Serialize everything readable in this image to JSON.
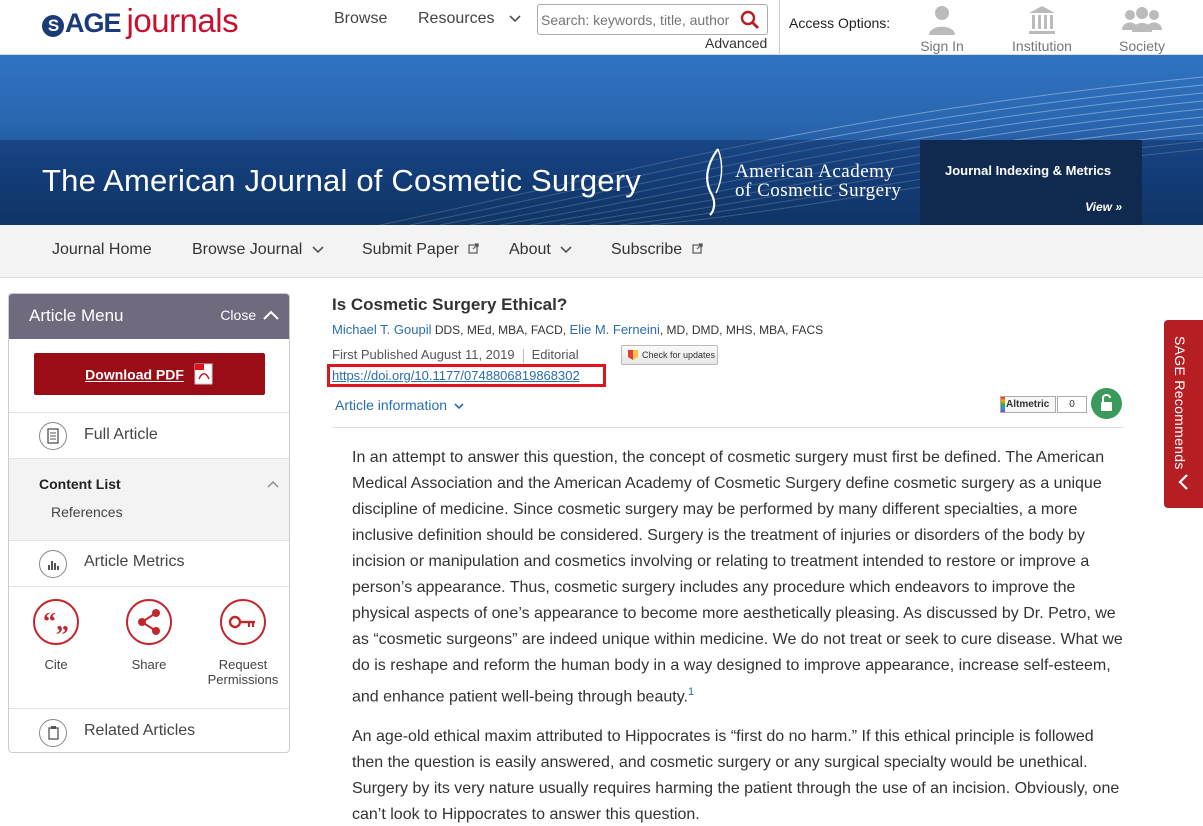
{
  "header": {
    "logo_brand": "SAGE",
    "logo_journals": "journals",
    "nav_browse": "Browse",
    "nav_resources": "Resources",
    "search_placeholder": "Search: keywords, title, author",
    "advanced": "Advanced",
    "access_label": "Access Options:",
    "sign_in": "Sign In",
    "institution": "Institution",
    "society": "Society"
  },
  "banner": {
    "journal_title": "The American Journal of Cosmetic Surgery",
    "aacs_line1": "American Academy",
    "aacs_line2": "of Cosmetic Surgery",
    "metrics_title": "Journal Indexing & Metrics",
    "metrics_view": "View »"
  },
  "journal_nav": {
    "home": "Journal Home",
    "browse": "Browse Journal",
    "submit": "Submit Paper",
    "about": "About",
    "subscribe": "Subscribe"
  },
  "article_menu": {
    "title": "Article Menu",
    "close": "Close",
    "download_pdf": "Download PDF",
    "full_article": "Full Article",
    "content_list": "Content List",
    "references": "References",
    "article_metrics": "Article Metrics",
    "cite": "Cite",
    "share": "Share",
    "request_permissions_1": "Request",
    "request_permissions_2": "Permissions",
    "related_articles": "Related Articles"
  },
  "article": {
    "title": "Is Cosmetic Surgery Ethical?",
    "author1": "Michael T. Goupil",
    "author1_creds": "DDS, MEd, MBA, FACD,",
    "author2": "Elie M. Ferneini",
    "author2_creds": ", MD, DMD, MHS, MBA, FACS",
    "first_published": "First Published August 11, 2019",
    "article_type": "Editorial",
    "check_updates": "Check for updates",
    "doi": "https://doi.org/10.1177/0748806819868302",
    "article_information": "Article information",
    "altmetric": "Altmetric",
    "altmetric_count": "0",
    "para1": "In an attempt to answer this question, the concept of cosmetic surgery must first be defined. The American Medical Association and the American Academy of Cosmetic Surgery define cosmetic surgery as a unique discipline of medicine. Since cosmetic surgery may be performed by many different specialties, a more inclusive definition should be considered. Surgery is the treatment of injuries or disorders of the body by incision or manipulation and cosmetics involving or relating to treatment intended to restore or improve a person’s appearance. Thus, cosmetic surgery includes any procedure which endeavors to improve the physical aspects of one’s appearance to become more aesthetically pleasing. As discussed by Dr. Petro, we as “cosmetic surgeons” are indeed unique within medicine. We do not treat or seek to cure disease. What we do is reshape and reform the human body in a way designed to improve appearance, increase self-esteem, and enhance patient well-being through beauty.",
    "para1_ref": "1",
    "para2": "An age-old ethical maxim attributed to Hippocrates is “first do no harm.” If this ethical principle is followed then the question is easily answered, and cosmetic surgery or any surgical specialty would be unethical. Surgery by its very nature usually requires harming the patient through the use of an incision. Obviously, one can’t look to Hippocrates to answer this question."
  },
  "sidebar_tab": {
    "label": "SAGE Recommends"
  },
  "colors": {
    "sage_blue": "#1a3a7a",
    "sage_red": "#c8102e",
    "menu_header": "#6f6a7e",
    "download_red": "#9b0d16",
    "link_blue": "#2b6cb0",
    "highlight_red": "#e0141d",
    "open_access_green": "#3a9a5c"
  }
}
